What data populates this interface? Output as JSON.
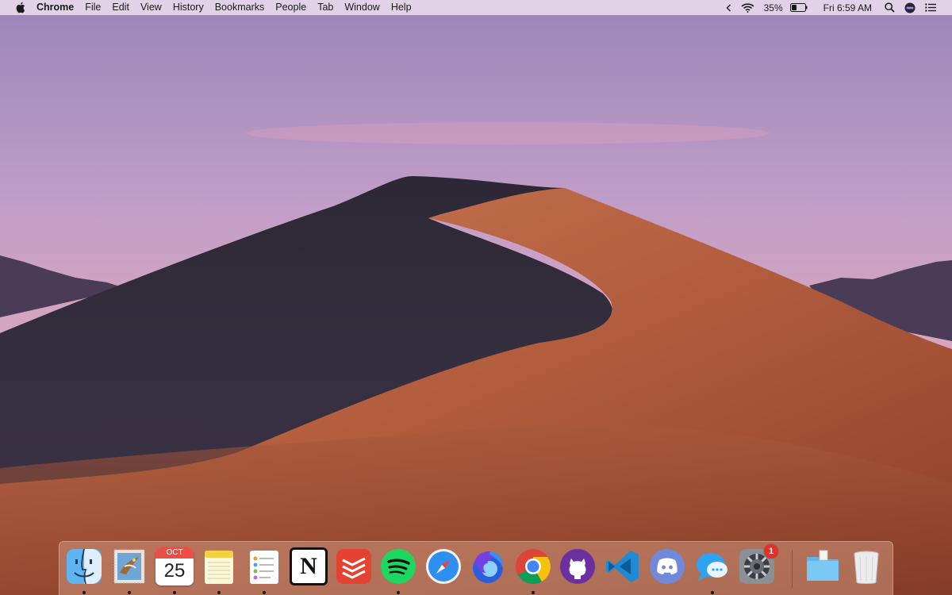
{
  "menubar": {
    "app_name": "Chrome",
    "menus": [
      "File",
      "Edit",
      "View",
      "History",
      "Bookmarks",
      "People",
      "Tab",
      "Window",
      "Help"
    ],
    "battery_percent": "35%",
    "clock": "Fri 6:59 AM"
  },
  "dock": {
    "apps": [
      {
        "name": "Finder",
        "icon": "finder-icon",
        "running": true
      },
      {
        "name": "Mail",
        "icon": "mail-stamp-icon",
        "running": true
      },
      {
        "name": "Calendar",
        "icon": "calendar-icon",
        "running": true,
        "month": "OCT",
        "day": "25"
      },
      {
        "name": "Notes",
        "icon": "notes-icon",
        "running": true
      },
      {
        "name": "Reminders",
        "icon": "reminders-icon",
        "running": true
      },
      {
        "name": "Notion",
        "icon": "notion-icon",
        "running": false,
        "glyph": "N"
      },
      {
        "name": "Todoist",
        "icon": "todoist-icon",
        "running": false
      },
      {
        "name": "Spotify",
        "icon": "spotify-icon",
        "running": true
      },
      {
        "name": "Safari",
        "icon": "safari-compass-icon",
        "running": false
      },
      {
        "name": "Firefox",
        "icon": "firefox-icon",
        "running": false
      },
      {
        "name": "Chrome",
        "icon": "chrome-icon",
        "running": true
      },
      {
        "name": "GitHub Desktop",
        "icon": "github-icon",
        "running": false
      },
      {
        "name": "Visual Studio Code",
        "icon": "vscode-icon",
        "running": false
      },
      {
        "name": "Discord",
        "icon": "discord-icon",
        "running": false
      },
      {
        "name": "Messages",
        "icon": "messages-icon",
        "running": true
      },
      {
        "name": "System Preferences",
        "icon": "gear-icon",
        "running": false,
        "badge": "1"
      },
      {
        "name": "Downloads",
        "icon": "folder-icon",
        "running": false
      },
      {
        "name": "Trash",
        "icon": "trash-icon",
        "running": false
      }
    ]
  },
  "colors": {
    "sky_top": "#9d88b9",
    "sky_bottom": "#e2a6ad",
    "dune_shadow": "#2e2a38",
    "dune_lit": "#b45e3d",
    "badge": "#e4302a"
  }
}
